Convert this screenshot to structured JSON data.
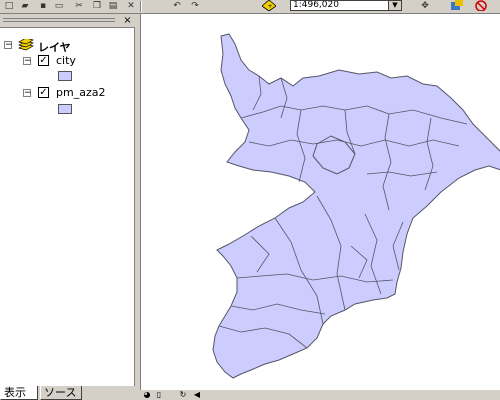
{
  "toolbar": {
    "scale_value": "1:496,020",
    "buttons": [
      "new-icon",
      "open-icon",
      "save-icon",
      "print-icon",
      "cut-icon",
      "copy-icon",
      "paste-icon",
      "delete-icon",
      "undo-icon",
      "redo-icon",
      "add-data-icon",
      "select-icon",
      "identify-icon",
      "stop-icon"
    ]
  },
  "toc": {
    "root_label": "レイヤ",
    "layers": [
      {
        "name": "city",
        "checked": true,
        "color": "#ccccff"
      },
      {
        "name": "pm_aza2",
        "checked": true,
        "color": "#ccccff"
      }
    ]
  },
  "tabs": [
    {
      "label": "表示",
      "active": true
    },
    {
      "label": "ソース",
      "active": false
    }
  ],
  "map": {
    "fill_color": "#ccccff",
    "stroke_color": "#555566"
  }
}
